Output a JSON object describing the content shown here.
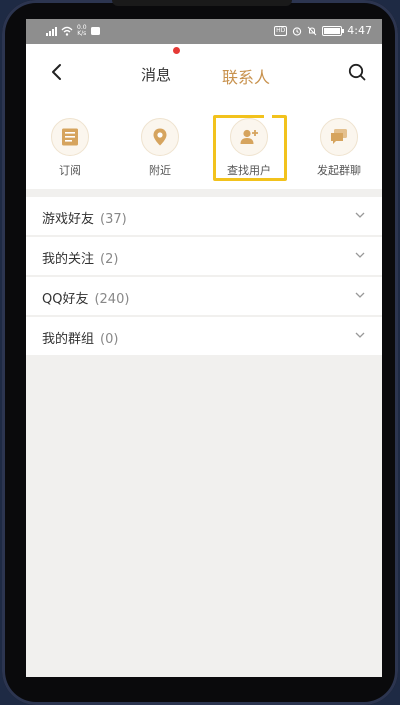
{
  "status_bar": {
    "net_speed": "0.0",
    "net_unit": "K/s",
    "time": "4:47",
    "battery_level": 0.9
  },
  "header": {
    "tabs": [
      {
        "label": "消息",
        "active": false,
        "has_dot": true
      },
      {
        "label": "联系人",
        "active": true
      }
    ],
    "accent_color": "#c8924e",
    "dot_color": "#e53935"
  },
  "actions": [
    {
      "label": "订阅",
      "icon": "subscribe-list-icon"
    },
    {
      "label": "附近",
      "icon": "location-pin-icon"
    },
    {
      "label": "查找用户",
      "icon": "add-user-icon",
      "highlighted": true
    },
    {
      "label": "发起群聊",
      "icon": "chat-bubbles-icon"
    }
  ],
  "groups": [
    {
      "name": "游戏好友",
      "count": "(37)"
    },
    {
      "name": "我的关注",
      "count": "(2)"
    },
    {
      "name": "QQ好友",
      "count": "(240)"
    },
    {
      "name": "我的群组",
      "count": "(0)"
    }
  ]
}
